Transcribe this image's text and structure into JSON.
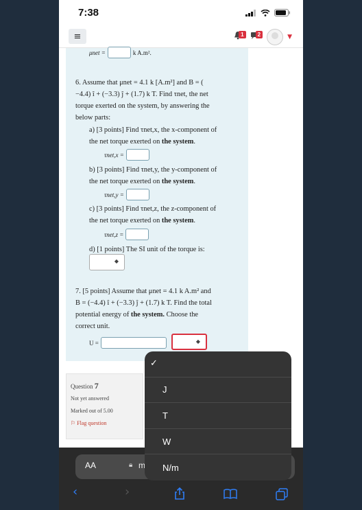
{
  "status": {
    "time": "7:38"
  },
  "nav": {
    "menu_label": "≡",
    "notif_count": "1",
    "msg_count": "2"
  },
  "prev_answer": {
    "label": "μnet =",
    "unit": "k  A.m²."
  },
  "q6": {
    "intro_a": "6. Assume that μnet = 4.1 k [A.m²] and B = (",
    "intro_b": "−4.4) î + (−3.3) ĵ + (1.7) k T. Find τnet, the net",
    "intro_c": "torque exerted on the system, by answering the",
    "intro_d": "below parts:",
    "a1": "a) [3 points] Find τnet,x, the x-component of",
    "a2": "the net torque exerted on",
    "a_label": "τnet,x =",
    "b1": "b) [3 points] Find τnet,y, the y-component of",
    "b2": "the net torque exerted on",
    "b_label": "τnet,y =",
    "c1": "c) [3 points] Find τnet,z, the z-component of",
    "c2": "the net torque exerted on",
    "c_label": "τnet,z =",
    "bold_system": "the system",
    "d1": "d) [1 points] The SI unit of the torque is:"
  },
  "q7": {
    "l1": "7. [5 points] Assume that μnet = 4.1 k  A.m² and",
    "l2": "B = (−4.4) î + (−3.3) ĵ + (1.7) k T. Find the total",
    "l3a": "potential energy of",
    "l3b": "the system.",
    "l3c": "Choose the",
    "l4": "correct unit.",
    "u_label": "U ="
  },
  "question_info": {
    "q_prefix": "Question",
    "q_number": "7",
    "state": "Not yet answered",
    "marks": "Marked out of 5.00",
    "flag": "Flag question"
  },
  "picker": {
    "check": "✓",
    "options": [
      "J",
      "T",
      "W",
      "N/m"
    ]
  },
  "browser": {
    "aa": "AA",
    "url_partial": "m"
  },
  "colors": {
    "accent": "#2f7ef6",
    "danger": "#d9303e",
    "content_bg": "#e6f2f6"
  }
}
